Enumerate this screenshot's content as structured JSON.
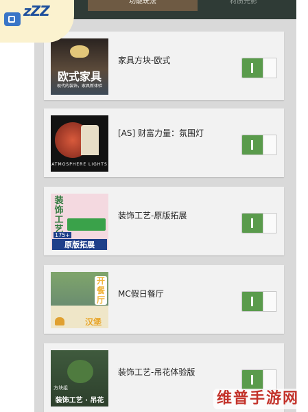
{
  "tabs": [
    {
      "label": "功能玩法",
      "active": true
    },
    {
      "label": "材质光影",
      "active": false
    }
  ],
  "mods": [
    {
      "name": "家具方块-欧式",
      "thumb_title": "欧式家具",
      "thumb_sub": "现代的装饰，家具新体验",
      "enabled": true
    },
    {
      "name": "[AS] 财富力量：氛围灯",
      "thumb_title": "ATMOSPHERE LIGHTS",
      "enabled": true
    },
    {
      "name": "装饰工艺-原版拓展",
      "thumb_title": "装饰工艺",
      "thumb_badge": "175+",
      "thumb_sub": "原版拓展",
      "enabled": true
    },
    {
      "name": "MC假日餐厅",
      "thumb_title": "开餐厅",
      "thumb_sub": "汉堡",
      "enabled": true
    },
    {
      "name": "装饰工艺-吊花体验版",
      "thumb_title": "装饰工艺 · 吊花",
      "thumb_top": "方块组",
      "enabled": true
    }
  ],
  "badge": {
    "text": "zZZ"
  },
  "watermark": {
    "text": "维普手游网"
  },
  "colors": {
    "toggle_on": "#5a9b4c",
    "tab_active": "#6e5a43"
  }
}
